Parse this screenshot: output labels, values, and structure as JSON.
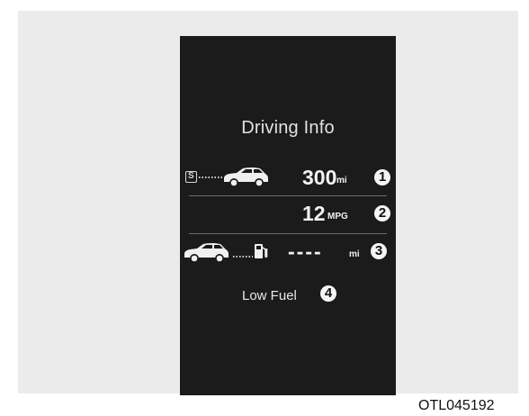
{
  "screen": {
    "title": "Driving Info",
    "range": {
      "value": "300",
      "unit": "mi",
      "marker": "1",
      "start_label": "S"
    },
    "fuel_economy": {
      "value": "12",
      "unit": "MPG",
      "marker": "2"
    },
    "distance_to_fuel": {
      "value": "----",
      "unit": "mi",
      "marker": "3"
    },
    "low_fuel": {
      "label": "Low Fuel",
      "marker": "4"
    }
  },
  "figure_code": "OTL045192",
  "icons": [
    "car-icon",
    "fuel-pump-icon",
    "dotted-line-icon"
  ]
}
